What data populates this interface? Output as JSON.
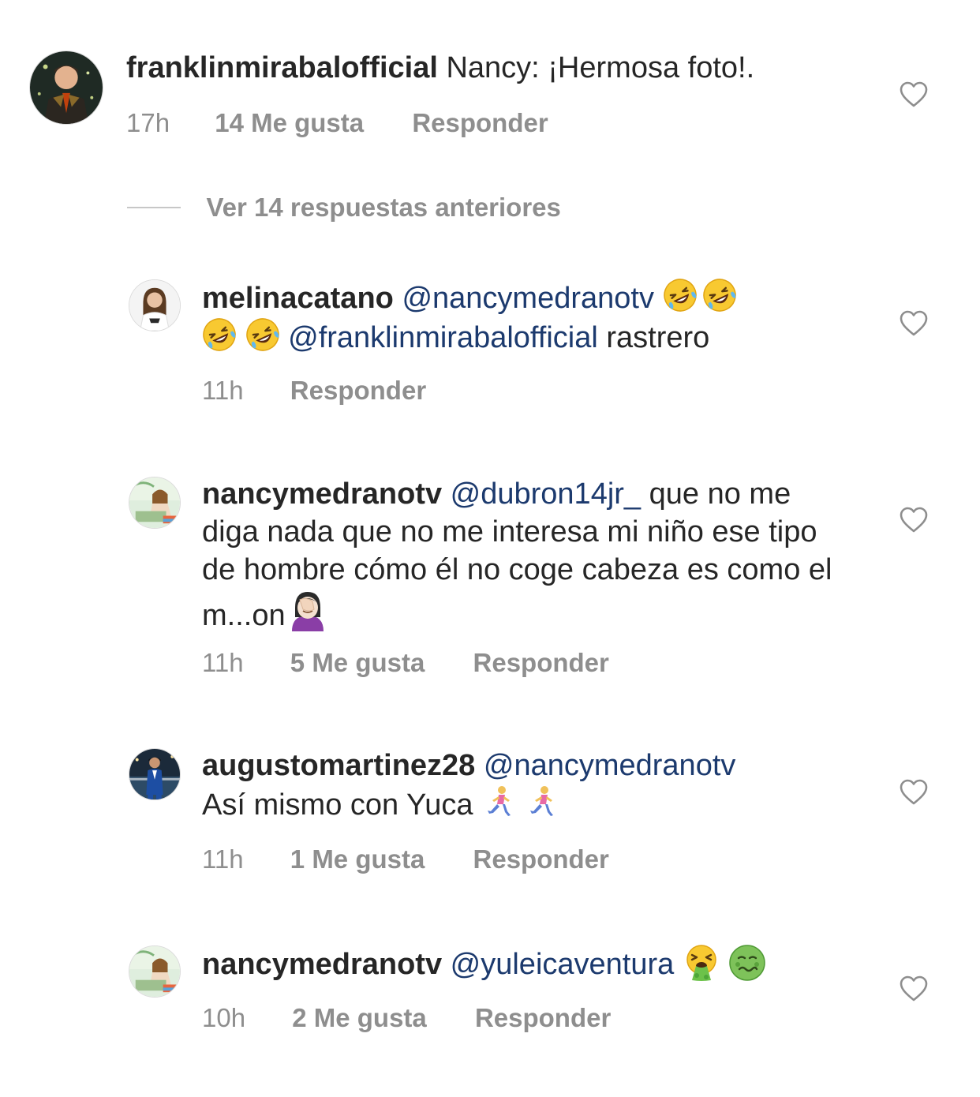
{
  "thread": {
    "view_more_label": "Ver 14 respuestas anteriores"
  },
  "comments": [
    {
      "username": "franklinmirabalofficial",
      "text": "Nancy: ¡Hermosa foto!.",
      "time": "17h",
      "likes": "14 Me gusta",
      "reply": "Responder"
    },
    {
      "username": "melinacatano",
      "mention1": "@nancymedranotv",
      "mention2": "@franklinmirabalofficial",
      "text_after": "rastrero",
      "emojis": [
        "rolling-on-floor-laughing",
        "rolling-on-floor-laughing",
        "rolling-on-floor-laughing",
        "rolling-on-floor-laughing"
      ],
      "time": "11h",
      "reply": "Responder"
    },
    {
      "username": "nancymedranotv",
      "mention": "@dubron14jr_",
      "text": "que no me diga nada que no me interesa mi niño ese tipo de hombre cómo él no coge cabeza es como el m...on",
      "emojis": [
        "woman-facepalming"
      ],
      "time": "11h",
      "likes": "5 Me gusta",
      "reply": "Responder"
    },
    {
      "username": "augustomartinez28",
      "mention": "@nancymedranotv",
      "text": "Así mismo con Yuca",
      "emojis": [
        "person-running",
        "person-running"
      ],
      "time": "11h",
      "likes": "1 Me gusta",
      "reply": "Responder"
    },
    {
      "username": "nancymedranotv",
      "mention": "@yuleicaventura",
      "emojis": [
        "face-vomiting",
        "nauseated-face"
      ],
      "time": "10h",
      "likes": "2 Me gusta",
      "reply": "Responder"
    }
  ],
  "icons": {
    "like": "heart-outline-icon"
  },
  "colors": {
    "text": "#262626",
    "meta": "#8e8e8e",
    "mention": "#1c3a6e",
    "divider": "#c7c7c7"
  }
}
